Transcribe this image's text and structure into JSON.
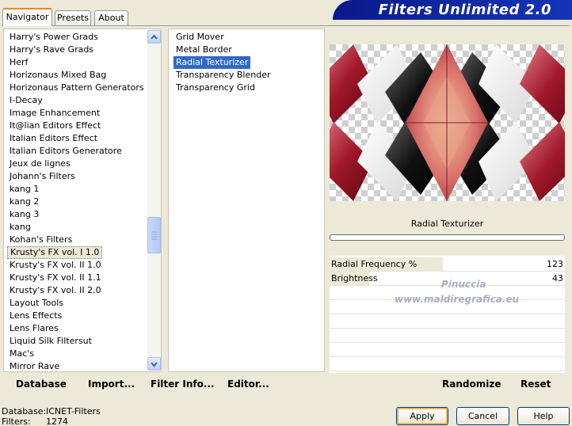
{
  "tabs": [
    {
      "label": "Navigator",
      "active": true
    },
    {
      "label": "Presets",
      "active": false
    },
    {
      "label": "About",
      "active": false
    }
  ],
  "banner": "Filters Unlimited 2.0",
  "categories": [
    "Harry's Power Grads",
    "Harry's Rave Grads",
    "Herf",
    "Horizonaus Mixed Bag",
    "Horizonaus Pattern Generators",
    "I-Decay",
    "Image Enhancement",
    "It@lian Editors Effect",
    "Italian Editors Effect",
    "Italian Editors Generatore",
    "Jeux de lignes",
    "Johann's Filters",
    "kang 1",
    "kang 2",
    "kang 3",
    "kang",
    "Kohan's Filters",
    "Krusty's FX vol. I 1.0",
    "Krusty's FX vol. II 1.0",
    "Krusty's FX vol. II 1.1",
    "Krusty's FX vol. II 2.0",
    "Layout Tools",
    "Lens Effects",
    "Lens Flares",
    "Liquid Silk Filtersut",
    "Mac's",
    "Mirror Rave"
  ],
  "selected_category_index": 17,
  "filters": [
    "Grid Mover",
    "Metal Border",
    "Radial Texturizer",
    "Transparency Blender",
    "Transparency Grid"
  ],
  "selected_filter_index": 2,
  "filter_title": "Radial Texturizer",
  "params": [
    {
      "label": "Radial Frequency %",
      "value": "123",
      "fraction": 0.48
    },
    {
      "label": "Brightness",
      "value": "43",
      "fraction": 0.17
    }
  ],
  "watermark": [
    "Pinuccia",
    "www.maldiregrafica.eu"
  ],
  "bottom_buttons": {
    "database": "Database",
    "import": "Import...",
    "filter_info": "Filter Info...",
    "editor": "Editor...",
    "randomize": "Randomize",
    "reset": "Reset"
  },
  "status": {
    "database_label": "Database:",
    "database_value": "ICNET-Filters",
    "filters_label": "Filters:",
    "filters_value": "1274"
  },
  "dialog_buttons": {
    "apply": "Apply",
    "cancel": "Cancel",
    "help": "Help"
  },
  "colors": {
    "selection": "#316ac5",
    "banner": "#0b1a8a",
    "accent_tab": "#e68b2c"
  }
}
